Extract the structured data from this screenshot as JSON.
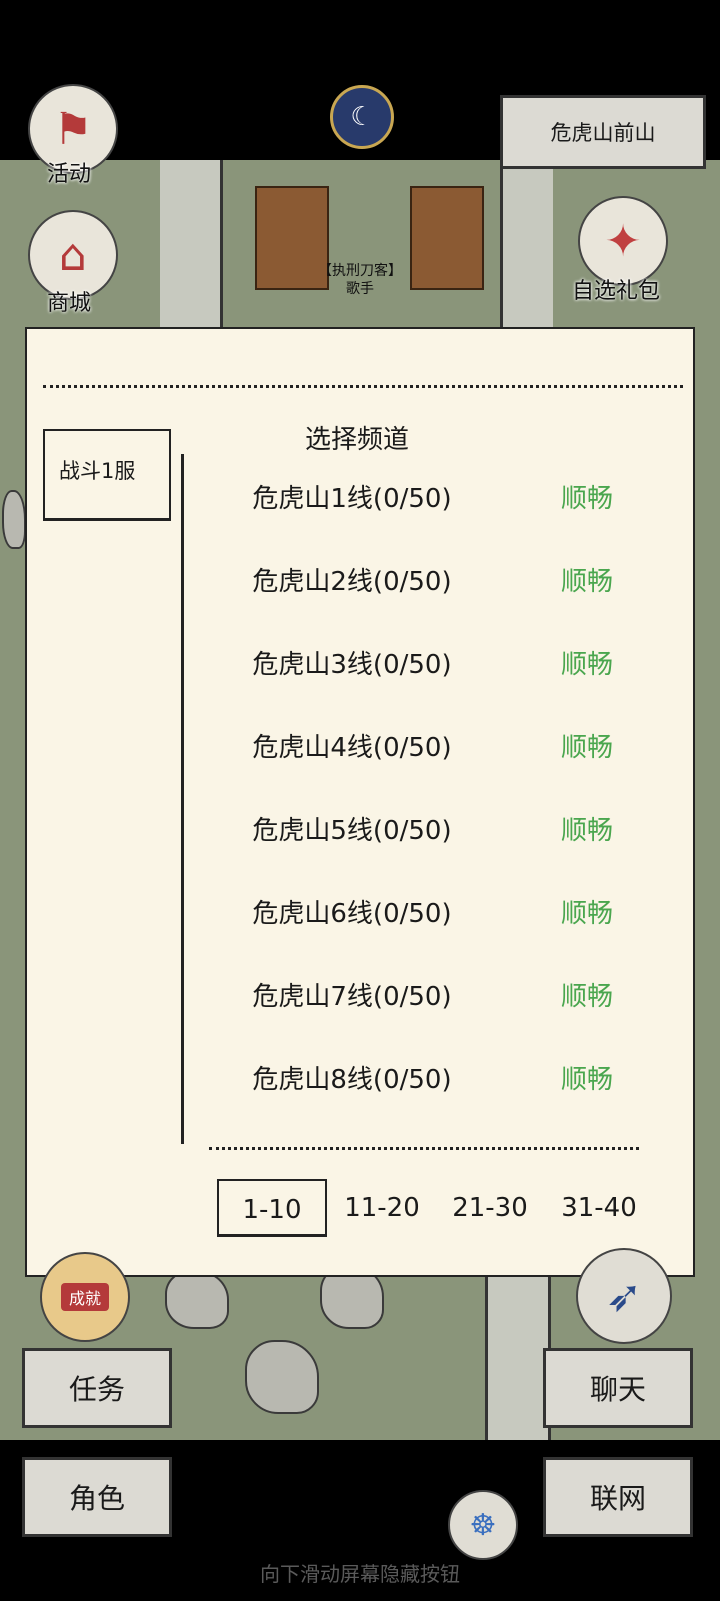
{
  "top": {
    "activity_label": "活动",
    "shop_label": "商城",
    "gift_label": "自选礼包",
    "location": "危虎山前山"
  },
  "scene": {
    "npc_title": "【执刑刀客】",
    "npc_name": "歌手"
  },
  "dialog": {
    "title": "选择频道",
    "server_tab": "战斗1服",
    "channels": [
      {
        "name": "危虎山1线(0/50)",
        "status": "顺畅"
      },
      {
        "name": "危虎山2线(0/50)",
        "status": "顺畅"
      },
      {
        "name": "危虎山3线(0/50)",
        "status": "顺畅"
      },
      {
        "name": "危虎山4线(0/50)",
        "status": "顺畅"
      },
      {
        "name": "危虎山5线(0/50)",
        "status": "顺畅"
      },
      {
        "name": "危虎山6线(0/50)",
        "status": "顺畅"
      },
      {
        "name": "危虎山7线(0/50)",
        "status": "顺畅"
      },
      {
        "name": "危虎山8线(0/50)",
        "status": "顺畅"
      }
    ],
    "pages": [
      "1-10",
      "11-20",
      "21-30",
      "31-40"
    ],
    "active_page": "1-10",
    "status_color": "#4aa64e"
  },
  "bottom": {
    "task": "任务",
    "chat": "聊天",
    "role": "角色",
    "network": "联网",
    "achievement_badge": "成就",
    "hint": "向下滑动屏幕隐藏按钮"
  }
}
